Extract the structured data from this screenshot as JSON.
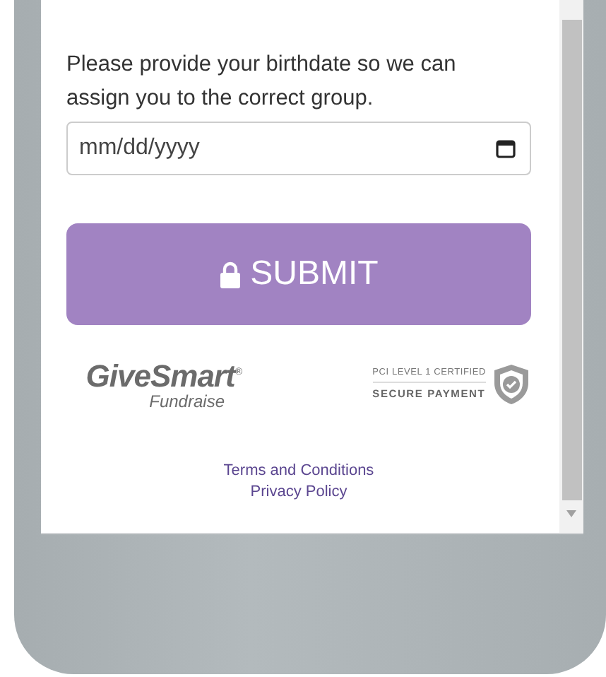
{
  "prompt": "Please provide your birthdate so we can assign you to the correct group.",
  "birthdate": {
    "placeholder": "mm/dd/yyyy"
  },
  "submit": {
    "label": "SUBMIT"
  },
  "logo": {
    "name": "GiveSmart",
    "mark": "®",
    "subtitle": "Fundraise"
  },
  "security_badge": {
    "line_1": "PCI LEVEL 1 CERTIFIED",
    "line_2": "SECURE PAYMENT"
  },
  "links": [
    "Terms and Conditions",
    "Privacy Policy"
  ]
}
